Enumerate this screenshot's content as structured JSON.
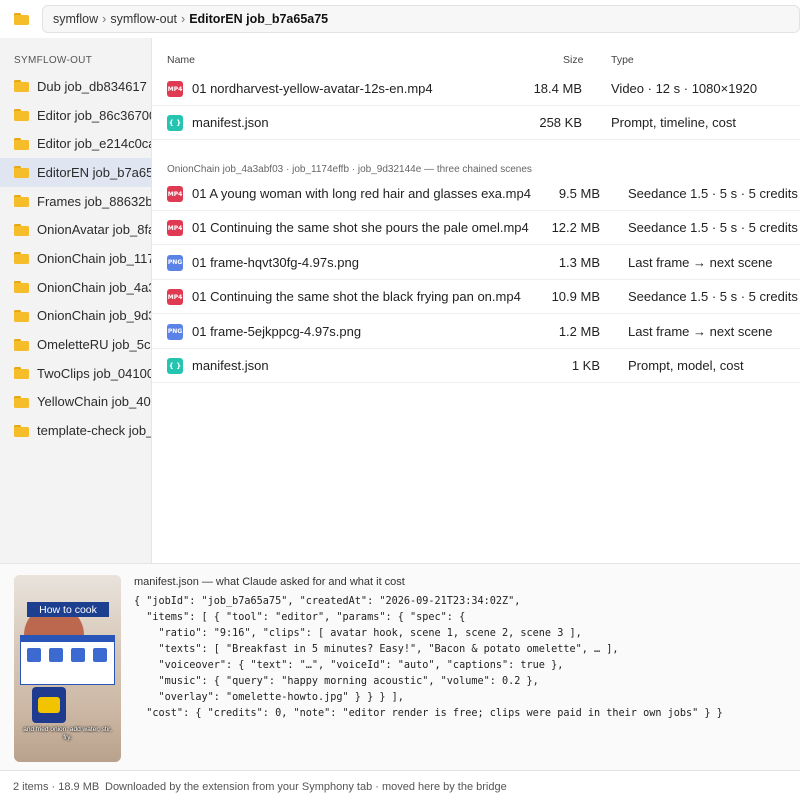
{
  "breadcrumb": [
    "symflow",
    "symflow-out",
    "EditorEN job_b7a65a75"
  ],
  "sidebar": {
    "heading": "SYMFLOW-OUT",
    "items": [
      {
        "label": "Dub job_db834617",
        "active": false
      },
      {
        "label": "Editor job_86c36700",
        "active": false
      },
      {
        "label": "Editor job_e214c0ca",
        "active": false
      },
      {
        "label": "EditorEN job_b7a65a75",
        "active": true
      },
      {
        "label": "Frames job_88632b7",
        "active": false
      },
      {
        "label": "OnionAvatar job_8fa",
        "active": false
      },
      {
        "label": "OnionChain job_1174",
        "active": false
      },
      {
        "label": "OnionChain job_4a3",
        "active": false
      },
      {
        "label": "OnionChain job_9d3",
        "active": false
      },
      {
        "label": "OmeletteRU job_5cc",
        "active": false
      },
      {
        "label": "TwoClips job_04100c",
        "active": false
      },
      {
        "label": "YellowChain job_403",
        "active": false
      },
      {
        "label": "template-check job_",
        "active": false
      }
    ]
  },
  "list": {
    "headers": {
      "name": "Name",
      "size": "Size",
      "type": "Type"
    },
    "top_files": [
      {
        "badge": "MP4",
        "kind": "mp4",
        "name": "01 nordharvest-yellow-avatar-12s-en.mp4",
        "size": "18.4 MB",
        "type": "Video · 12 s · 1080×1920"
      },
      {
        "badge": "{ }",
        "kind": "json",
        "name": "manifest.json",
        "size": "258 KB",
        "type": "Prompt, timeline, cost"
      }
    ],
    "group_label": "OnionChain job_4a3abf03 · job_1174effb · job_9d32144e — three chained scenes",
    "group_files": [
      {
        "badge": "MP4",
        "kind": "mp4",
        "name": "01 A young woman with long red hair and glasses exa.mp4",
        "size": "9.5 MB",
        "type": "Seedance 1.5 · 5 s · 5 credits"
      },
      {
        "badge": "MP4",
        "kind": "mp4",
        "name": "01 Continuing the same shot she pours the pale omel.mp4",
        "size": "12.2 MB",
        "type": "Seedance 1.5 · 5 s · 5 credits"
      },
      {
        "badge": "PNG",
        "kind": "png",
        "name": "01 frame-hqvt30fg-4.97s.png",
        "size": "1.3 MB",
        "type": "Last frame → next scene"
      },
      {
        "badge": "MP4",
        "kind": "mp4",
        "name": "01 Continuing the same shot the black frying pan on.mp4",
        "size": "10.9 MB",
        "type": "Seedance 1.5 · 5 s · 5 credits"
      },
      {
        "badge": "PNG",
        "kind": "png",
        "name": "01 frame-5ejkppcg-4.97s.png",
        "size": "1.2 MB",
        "type": "Last frame → next scene"
      },
      {
        "badge": "{ }",
        "kind": "json",
        "name": "manifest.json",
        "size": "1 KB",
        "type": "Prompt, model, cost"
      }
    ]
  },
  "preview": {
    "thumb_title": "How to cook",
    "thumb_caption": "and fried onion: add water, stir, fry.",
    "title": "manifest.json — what Claude asked for and what it cost",
    "code_lines": [
      "{ \"jobId\": \"job_b7a65a75\", \"createdAt\": \"2026-09-21T23:34:02Z\",",
      "  \"items\": [ { \"tool\": \"editor\", \"params\": { \"spec\": {",
      "    \"ratio\": \"9:16\", \"clips\": [ avatar hook, scene 1, scene 2, scene 3 ],",
      "    \"texts\": [ \"Breakfast in 5 minutes? Easy!\", \"Bacon & potato omelette\", … ],",
      "    \"voiceover\": { \"text\": \"…\", \"voiceId\": \"auto\", \"captions\": true },",
      "    \"music\": { \"query\": \"happy morning acoustic\", \"volume\": 0.2 },",
      "    \"overlay\": \"omelette-howto.jpg\" } } } ],",
      "  \"cost\": { \"credits\": 0, \"note\": \"editor render is free; clips were paid in their own jobs\" } }"
    ]
  },
  "status": {
    "count": "2 items · 18.9 MB",
    "message": "Downloaded by the extension from your Symphony tab · moved here by the bridge"
  }
}
